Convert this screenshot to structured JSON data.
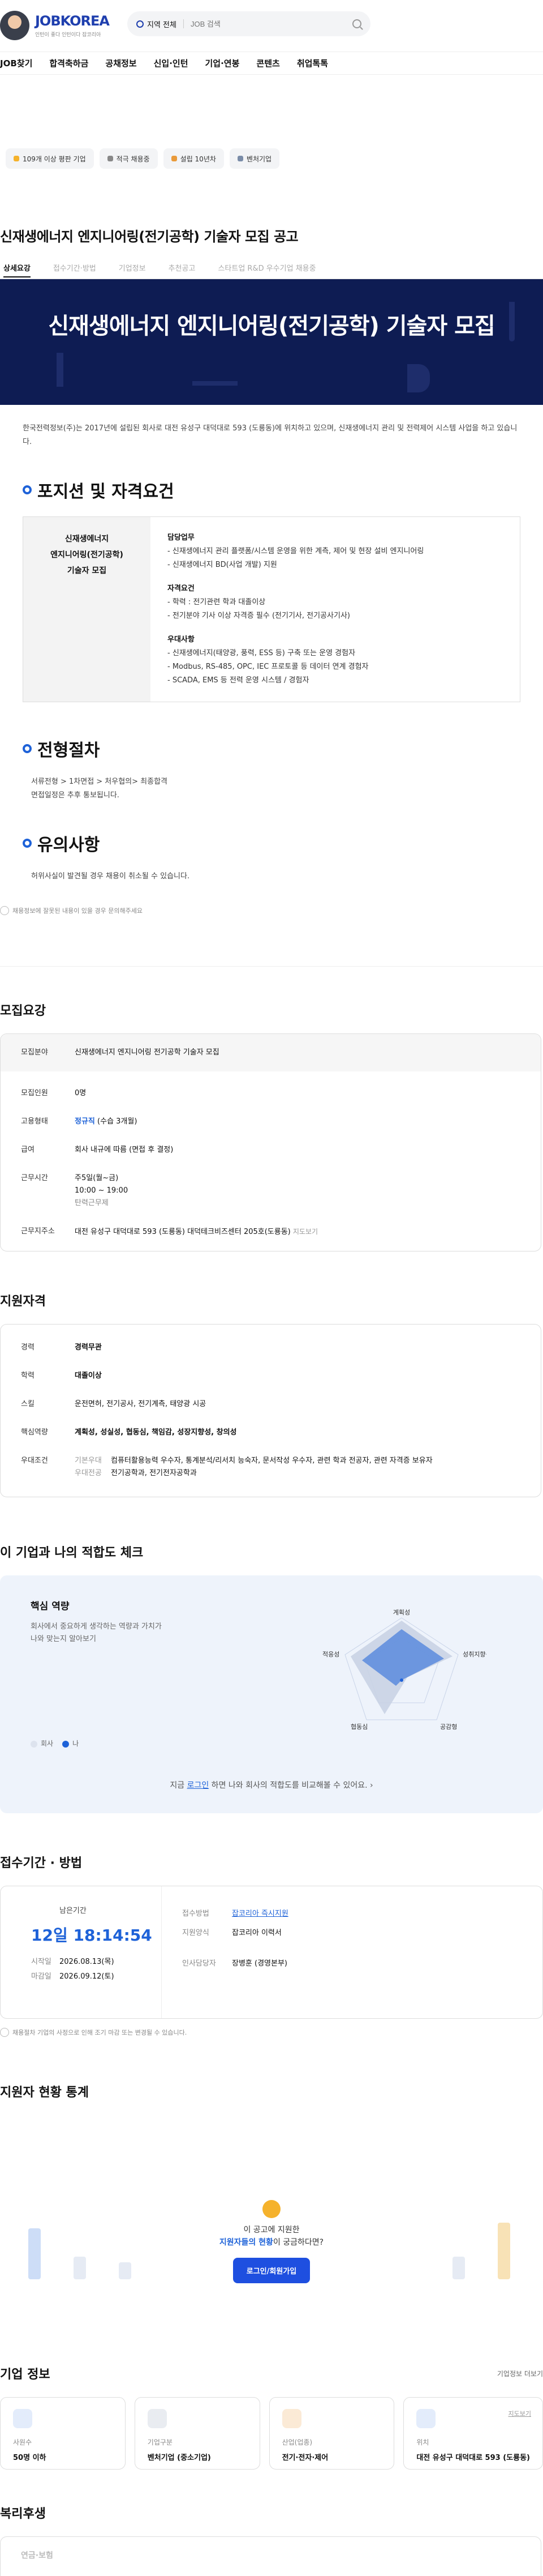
{
  "header": {
    "logo": "JOBKOREA",
    "logo_sub": "인턴이 좋다 인턴이다 잡코리아",
    "region": "지역 전체",
    "search_placeholder": "JOB 검색"
  },
  "nav": [
    "JOB찾기",
    "합격축하금",
    "공채정보",
    "신입·인턴",
    "기업·연봉",
    "콘텐츠",
    "취업톡톡"
  ],
  "chips": [
    "109개 이상 평판 기업",
    "적극 채용중",
    "설립 10년차",
    "벤처기업"
  ],
  "job_title": "신재생에너지 엔지니어링(전기공학) 기술자 모집 공고",
  "tabs": [
    "상세요강",
    "접수기간·방법",
    "기업정보",
    "추천공고",
    "스타트업 R&D 우수기업 채용중"
  ],
  "banner_title": "신재생에너지 엔지니어링(전기공학) 기술자 모집",
  "intro": "한국전력정보(주)는 2017년에 설립된 회사로 대전 유성구 대덕대로 593 (도룡동)에 위치하고 있으며, 신재생에너지 관리 및 전력제어 시스템 사업을 하고 있습니다.",
  "position": {
    "heading": "포지션 및 자격요건",
    "left_label": [
      "신재생에너지",
      "엔지니어링(전기공학)",
      "기술자 모집"
    ],
    "groups": [
      {
        "title": "담당업무",
        "items": [
          "- 신재생에너지 관리 플랫폼/시스템 운영을 위한 계측, 제어 및 현장 설비 엔지니어링",
          "- 신재생에너지 BD(사업 개발) 지원"
        ]
      },
      {
        "title": "자격요건",
        "items": [
          "- 학력 : 전기관련 학과 대졸이상",
          "- 전기분야 기사 이상 자격증 필수 (전기기사, 전기공사기사)"
        ]
      },
      {
        "title": "우대사항",
        "items": [
          "- 신재생에너지(태양광, 풍력, ESS 등) 구축 또는 운영 경험자",
          "- Modbus, RS-485, OPC, IEC 프로토콜 등 데이터 연계 경험자",
          "- SCADA, EMS 등 전력 운영 시스템 / 경험자"
        ]
      }
    ]
  },
  "process": {
    "heading": "전형절차",
    "lines": [
      "서류전형 > 1차면접 > 처우협의> 최종합격",
      "면접일정은 추후 통보됩니다."
    ]
  },
  "caution": {
    "heading": "유의사항",
    "lines": [
      "허위사실이 발견될 경우 채용이 취소될 수 있습니다."
    ]
  },
  "report_note": "채용정보에 잘못된 내용이 있을 경우 문의해주세요",
  "summary": {
    "heading": "모집요강",
    "field_label": "모집분야",
    "field_value": "신재생에너지 엔지니어링 전기공학 기술자 모집",
    "count_label": "모집인원",
    "count_value": "0명",
    "type_label": "고용형태",
    "type_value": "정규직",
    "type_extra": "(수습 3개월)",
    "salary_label": "급여",
    "salary_value": "회사 내규에 따름 (면접 후 결정)",
    "hours_label": "근무시간",
    "hours": [
      "주5일(월~금)",
      "10:00 ~ 19:00",
      "탄력근무제"
    ],
    "addr_label": "근무지주소",
    "addr_value": "대전 유성구 대덕대로 593 (도룡동) 대덕테크비즈센터 205호(도룡동)",
    "addr_link": "지도보기"
  },
  "qualification": {
    "heading": "지원자격",
    "career_label": "경력",
    "career_value": "경력무관",
    "edu_label": "학력",
    "edu_value": "대졸이상",
    "skill_label": "스킬",
    "skill_value": "운전면허, 전기공사, 전기계측, 태양광 시공",
    "core_label": "핵심역량",
    "core_value": "계획성, 성실성, 협동심, 책임감, 성장지향성, 창의성",
    "pref_label": "우대조건",
    "pref_basic_label": "기본우대",
    "pref_basic_value": "컴퓨터활용능력 우수자, 통계분석/리서치 능숙자, 문서작성 우수자, 관련 학과 전공자, 관련 자격증 보유자",
    "pref_major_label": "우대전공",
    "pref_major_value": "전기공학과, 전기전자공학과"
  },
  "fit": {
    "heading": "이 기업과 나의 적합도 체크",
    "title": "핵심 역량",
    "desc": "회사에서 중요하게 생각하는 역량과 가치가 나와 맞는지 알아보기",
    "axes": [
      "계획성",
      "성취지향성",
      "공감형",
      "협동심",
      "적응성"
    ],
    "legend_company": "회사",
    "legend_me": "나",
    "bottom_pre": "지금 ",
    "bottom_link": "로그인",
    "bottom_post": " 하면 나와 회사의 적합도를 비교해볼 수 있어요.",
    "colors": {
      "me": "#1e62d8",
      "company": "#c9d3e4"
    }
  },
  "deadline": {
    "heading": "접수기간 · 방법",
    "remain_label": "남은기간",
    "remain_value": "12일 18:14:54",
    "start_label": "시작일",
    "start_value": "2026.08.13(목)",
    "end_label": "마감일",
    "end_value": "2026.09.12(토)",
    "method_label": "접수방법",
    "method_value": "잡코리아 즉시지원",
    "form_label": "지원양식",
    "form_value": "잡코리아 이력서",
    "manager_label": "인사담당자",
    "manager_value": "장병훈 (경영본부)",
    "note": "채용절차 기업의 사정으로 인해 조기 마감 또는 변경될 수 있습니다."
  },
  "stats": {
    "heading": "지원자 현황 통계",
    "q1": "이 공고에 지원한",
    "q2_highlight": "지원자들의 현황",
    "q2_post": "이 궁금하다면?",
    "btn": "로그인/회원가입"
  },
  "company": {
    "heading": "기업 정보",
    "more": "기업정보 더보기",
    "cards": [
      {
        "label": "사원수",
        "value": "50명 이하"
      },
      {
        "label": "기업구분",
        "value": "벤처기업 (중소기업)"
      },
      {
        "label": "산업(업종)",
        "value": "전기·전자·제어"
      },
      {
        "label": "위치",
        "value": "대전 유성구 대덕대로 593 (도룡동)",
        "link": "지도보기"
      }
    ]
  },
  "welfare": {
    "heading": "복리후생",
    "sub": "연금·보험"
  }
}
